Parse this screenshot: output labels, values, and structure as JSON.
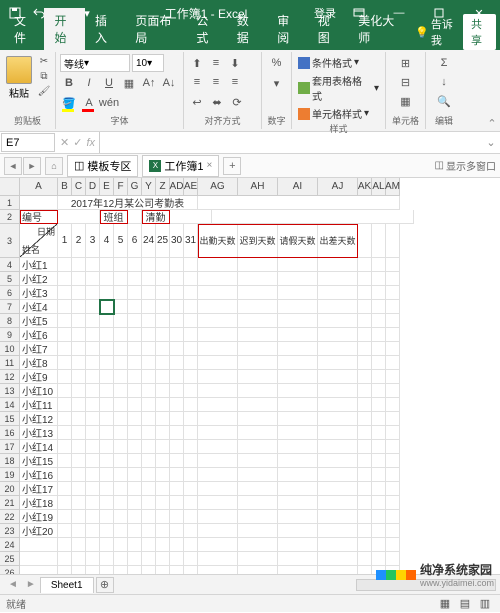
{
  "titlebar": {
    "title": "工作簿1 - Excel",
    "login": "登录"
  },
  "ribbon": {
    "tabs": [
      "文件",
      "开始",
      "插入",
      "页面布局",
      "公式",
      "数据",
      "审阅",
      "视图",
      "美化大师"
    ],
    "active_tab": 1,
    "tell_me": "告诉我",
    "share": "共享",
    "groups": {
      "clipboard": {
        "label": "剪贴板",
        "paste": "粘贴"
      },
      "font": {
        "label": "字体",
        "name": "等线",
        "size": "10"
      },
      "alignment": {
        "label": "对齐方式"
      },
      "number": {
        "label": "数字"
      },
      "styles": {
        "label": "样式",
        "cond_fmt": "条件格式",
        "table_fmt": "套用表格格式",
        "cell_styles": "单元格样式"
      },
      "cells": {
        "label": "单元格"
      },
      "editing": {
        "label": "编辑"
      }
    }
  },
  "name_box": "E7",
  "doc_tabs": {
    "template_zone": "模板专区",
    "active": "工作簿1",
    "show_more": "显示多窗口"
  },
  "sheet": {
    "title_row": "2017年12月某公司考勤表",
    "row2": {
      "a": "编号",
      "b": "班组",
      "c": "清勤"
    },
    "diag": {
      "top": "日期",
      "bot": "姓名"
    },
    "days": [
      "1",
      "2",
      "3",
      "4",
      "5",
      "6",
      "24",
      "25",
      "30",
      "31"
    ],
    "summary_headers": [
      "出勤天数",
      "迟到天数",
      "请假天数",
      "出差天数"
    ],
    "names": [
      "小红1",
      "小红2",
      "小红3",
      "小红4",
      "小红5",
      "小红6",
      "小红7",
      "小红8",
      "小红9",
      "小红10",
      "小红11",
      "小红12",
      "小红13",
      "小红14",
      "小红15",
      "小红16",
      "小红17",
      "小红18",
      "小红19",
      "小红20"
    ],
    "col_letters": [
      "A",
      "B",
      "C",
      "D",
      "E",
      "F",
      "G",
      "Y",
      "Z",
      "AD",
      "AE",
      "AG",
      "AH",
      "AI",
      "AJ",
      "AK",
      "AL",
      "AM"
    ]
  },
  "sheet_tab": "Sheet1",
  "status": "就绪",
  "watermark": {
    "brand": "纯净系统家园",
    "url": "www.yidaimei.com"
  }
}
